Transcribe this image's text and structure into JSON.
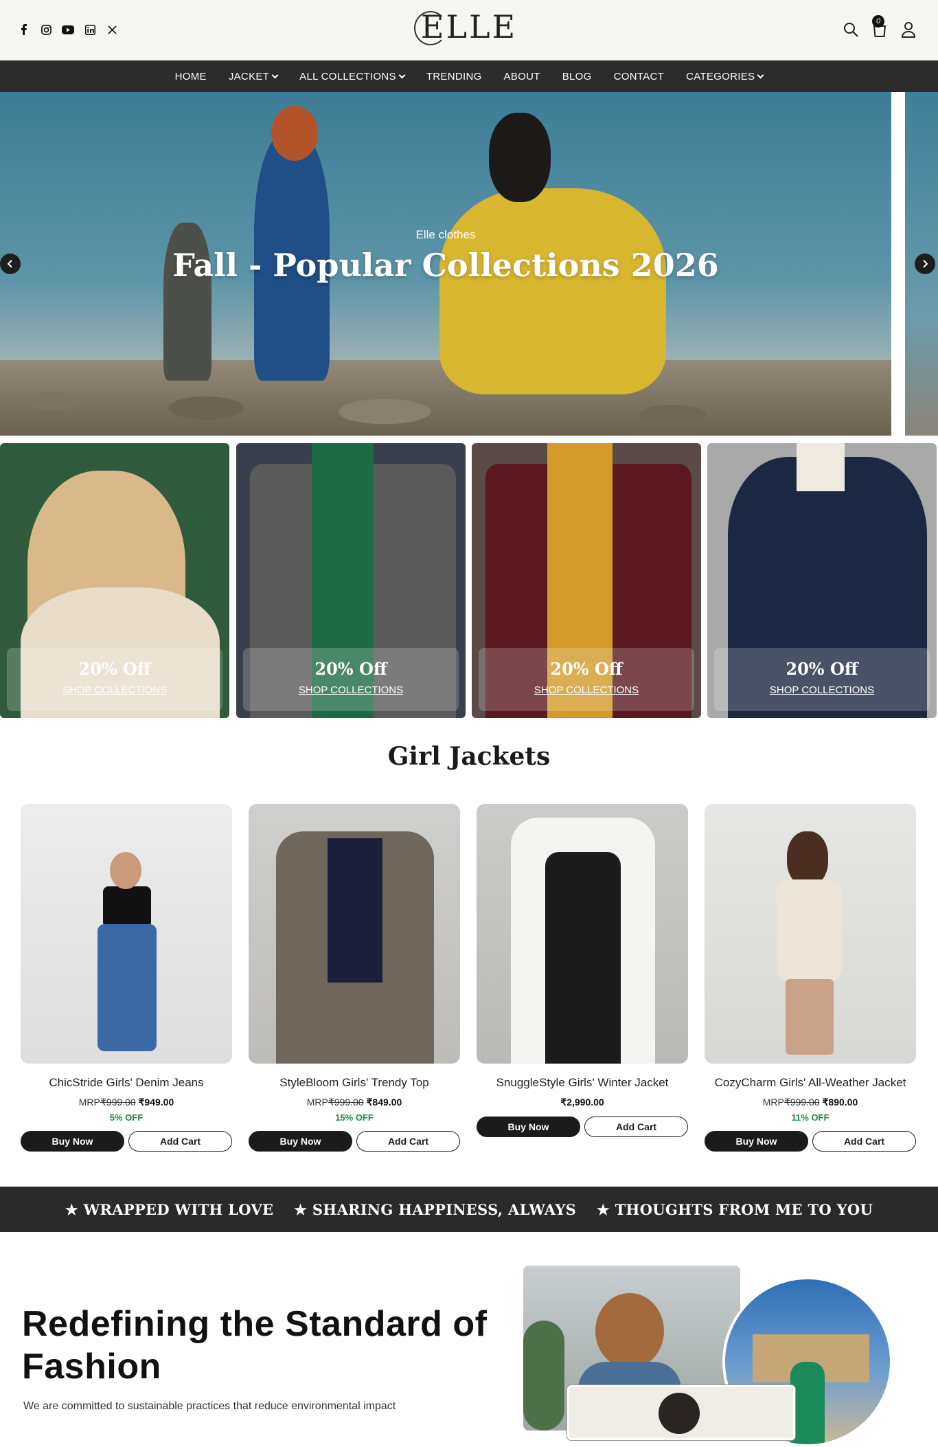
{
  "header": {
    "logo": "ELLE",
    "social_icons": [
      "facebook-icon",
      "instagram-icon",
      "youtube-icon",
      "linkedin-icon",
      "x-icon"
    ],
    "cart_count": "0"
  },
  "nav": {
    "items": [
      {
        "label": "HOME",
        "dropdown": false
      },
      {
        "label": "JACKET",
        "dropdown": true
      },
      {
        "label": "ALL COLLECTIONS",
        "dropdown": true
      },
      {
        "label": "TRENDING",
        "dropdown": false
      },
      {
        "label": "ABOUT",
        "dropdown": false
      },
      {
        "label": "BLOG",
        "dropdown": false
      },
      {
        "label": "CONTACT",
        "dropdown": false
      },
      {
        "label": "CATEGORIES",
        "dropdown": true
      }
    ]
  },
  "hero": {
    "kicker": "Elle clothes",
    "title": "Fall - Popular Collections 2026",
    "prev_icon": "chevron-left-icon",
    "next_icon": "chevron-right-icon"
  },
  "promos": [
    {
      "offer": "20% Off",
      "link": "SHOP COLLECTIONS"
    },
    {
      "offer": "20% Off",
      "link": "SHOP COLLECTIONS"
    },
    {
      "offer": "20% Off",
      "link": "SHOP COLLECTIONS"
    },
    {
      "offer": "20% Off",
      "link": "SHOP COLLECTIONS"
    }
  ],
  "section_title": "Girl Jackets",
  "products": [
    {
      "name": "ChicStride Girls' Denim Jeans",
      "mrp_label": "MRP",
      "mrp": "₹999.00",
      "price": "₹949.00",
      "discount": "5% OFF",
      "buy": "Buy Now",
      "add": "Add Cart"
    },
    {
      "name": "StyleBloom Girls' Trendy Top",
      "mrp_label": "MRP",
      "mrp": "₹999.00",
      "price": "₹849.00",
      "discount": "15% OFF",
      "buy": "Buy Now",
      "add": "Add Cart"
    },
    {
      "name": "SnuggleStyle Girls' Winter Jacket",
      "price": "₹2,990.00",
      "buy": "Buy Now",
      "add": "Add Cart"
    },
    {
      "name": "CozyCharm Girls' All-Weather Jacket",
      "mrp_label": "MRP",
      "mrp": "₹999.00",
      "price": "₹890.00",
      "discount": "11% OFF",
      "buy": "Buy Now",
      "add": "Add Cart"
    }
  ],
  "marquee": [
    "★ WRAPPED WITH LOVE",
    "★ SHARING HAPPINESS, ALWAYS",
    "★ THOUGHTS FROM ME TO YOU"
  ],
  "about": {
    "title": "Redefining the Standard of Fashion",
    "text": "We are committed to sustainable practices that reduce environmental impact"
  },
  "colors": {
    "header_bg": "#f6f7f2",
    "nav_bg": "#2b2b2b",
    "marquee_bg": "#2a2a2a",
    "discount_green": "#1c8a4a"
  }
}
